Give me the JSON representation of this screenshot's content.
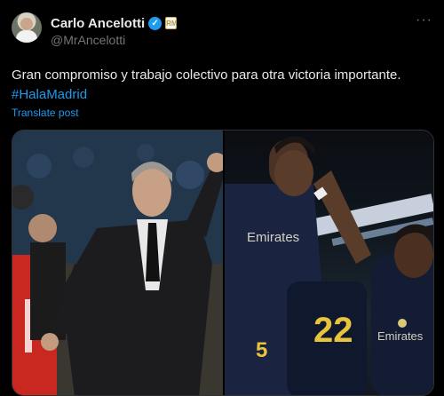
{
  "author": {
    "name": "Carlo Ancelotti",
    "handle": "@MrAncelotti",
    "verified_icon": "verified-check-icon",
    "affiliation_icon": "real-madrid-badge-icon"
  },
  "menu": {
    "more_label": "···"
  },
  "post": {
    "text": "Gran compromiso y trabajo colectivo para otra victoria importante.",
    "hashtag": "#HalaMadrid",
    "translate_label": "Translate post"
  },
  "media": {
    "count": 2,
    "images": [
      {
        "subject": "coach-gesturing-photo"
      },
      {
        "subject": "players-celebrating-photo",
        "jersey_number": "22",
        "jersey_number_2": "5",
        "sponsor": "Emirates"
      }
    ]
  },
  "colors": {
    "background": "#000000",
    "text": "#e7e9ea",
    "muted": "#71767b",
    "link": "#1d9bf0"
  }
}
